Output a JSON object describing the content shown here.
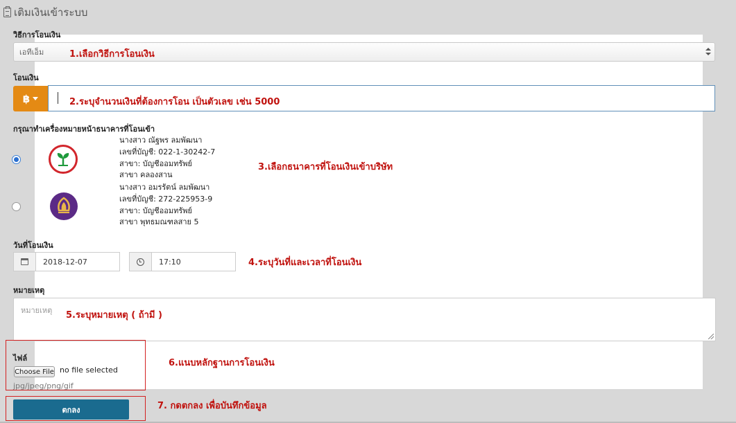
{
  "page": {
    "title": "เติมเงินเข้าระบบ"
  },
  "transfer_method": {
    "label": "วิธีการโอนเงิน",
    "selected": "เอทีเอ็ม",
    "annotation": "1.เลือกวิธีการโอนเงิน"
  },
  "amount": {
    "label": "โอนเงิน",
    "currency_symbol": "฿",
    "value": "",
    "annotation": "2.ระบุจำนวนเงินที่ต้องการโอน เป็นตัวเลข เช่น 5000"
  },
  "bank_select": {
    "label": "กรุณาทำเครื่องหมายหน้าธนาคารที่โอนเข้า",
    "annotation": "3.เลือกธนาคารที่โอนเงินเข้าบริษัท",
    "banks": [
      {
        "checked": true,
        "logo": "kasikorn-bank-logo",
        "lines": [
          "นางสาว ณัฐพร ลมพัฒนา",
          "เลขที่บัญชี: 022-1-30242-7",
          "สาขา: บัญชีออมทรัพย์",
          "สาขา คลองสาน"
        ]
      },
      {
        "checked": false,
        "logo": "siam-commercial-bank-logo",
        "lines": [
          "นางสาว อมรรัตน์ ลมพัฒนา",
          "เลขที่บัญชี: 272-225953-9",
          "สาขา: บัญชีออมทรัพย์",
          "สาขา พุทธมณฑลสาย 5"
        ]
      }
    ]
  },
  "transfer_date": {
    "label": "วันที่โอนเงิน",
    "date": "2018-12-07",
    "time": "17:10",
    "annotation": "4.ระบุวันที่และเวลาที่โอนเงิน"
  },
  "note": {
    "label": "หมายเหตุ",
    "placeholder": "หมายเหตุ",
    "annotation": "5.ระบุหมายเหตุ ( ถ้ามี )"
  },
  "file": {
    "label": "ไฟล์",
    "choose_button": "Choose File",
    "status": "no file selected",
    "hint": "jpg/jpeg/png/gif",
    "annotation": "6.แนบหลักฐานการโอนเงิน"
  },
  "submit": {
    "label": "ตกลง",
    "annotation": "7. กดตกลง เพื่อบันทึกข้อมูล"
  },
  "colors": {
    "accent_orange": "#e48a14",
    "submit_blue": "#1a6b8f",
    "annotation_red": "#c0120e"
  }
}
